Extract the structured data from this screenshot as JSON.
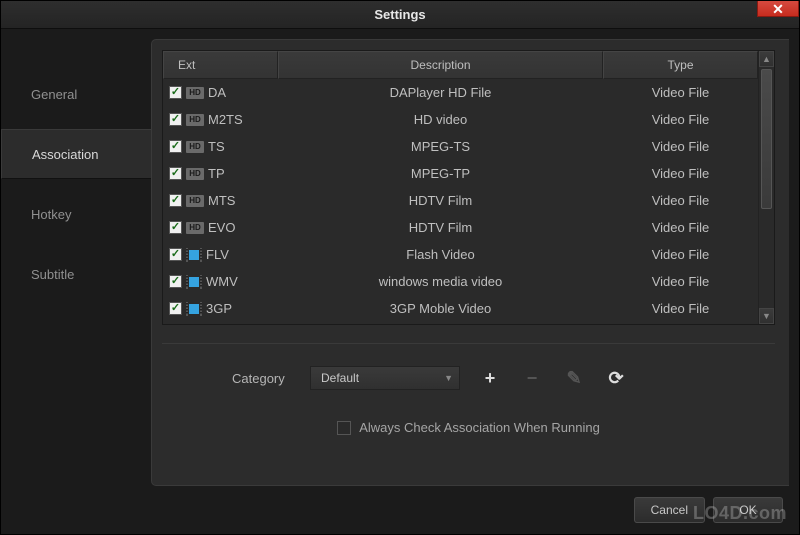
{
  "window": {
    "title": "Settings"
  },
  "sidebar": {
    "items": [
      {
        "label": "General",
        "active": false
      },
      {
        "label": "Association",
        "active": true
      },
      {
        "label": "Hotkey",
        "active": false
      },
      {
        "label": "Subtitle",
        "active": false
      }
    ]
  },
  "table": {
    "headers": {
      "ext": "Ext",
      "desc": "Description",
      "type": "Type"
    },
    "rows": [
      {
        "checked": true,
        "icon": "hd",
        "ext": "DA",
        "desc": "DAPlayer HD File",
        "type": "Video File"
      },
      {
        "checked": true,
        "icon": "hd",
        "ext": "M2TS",
        "desc": "HD video",
        "type": "Video File"
      },
      {
        "checked": true,
        "icon": "hd",
        "ext": "TS",
        "desc": "MPEG-TS",
        "type": "Video File"
      },
      {
        "checked": true,
        "icon": "hd",
        "ext": "TP",
        "desc": "MPEG-TP",
        "type": "Video File"
      },
      {
        "checked": true,
        "icon": "hd",
        "ext": "MTS",
        "desc": "HDTV Film",
        "type": "Video File"
      },
      {
        "checked": true,
        "icon": "hd",
        "ext": "EVO",
        "desc": "HDTV Film",
        "type": "Video File"
      },
      {
        "checked": true,
        "icon": "film",
        "ext": "FLV",
        "desc": "Flash Video",
        "type": "Video File"
      },
      {
        "checked": true,
        "icon": "film",
        "ext": "WMV",
        "desc": "windows media video",
        "type": "Video File"
      },
      {
        "checked": true,
        "icon": "film",
        "ext": "3GP",
        "desc": "3GP Moble Video",
        "type": "Video File"
      }
    ]
  },
  "category": {
    "label": "Category",
    "value": "Default"
  },
  "always_check": {
    "label": "Always Check Association When Running",
    "checked": false
  },
  "footer": {
    "cancel": "Cancel",
    "ok": "OK"
  },
  "watermark": "LO4D.com",
  "icons": {
    "hd_text": "HD",
    "checkmark": "✓",
    "plus": "+",
    "minus": "−",
    "pencil": "✎",
    "refresh": "⟳",
    "close": "✕",
    "up": "▲",
    "down": "▼"
  }
}
